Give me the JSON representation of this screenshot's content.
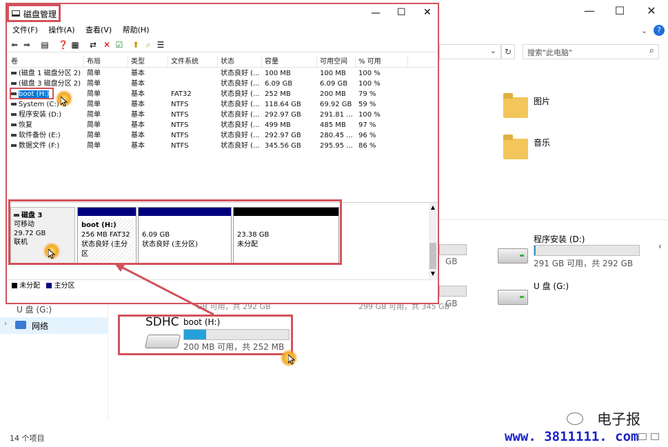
{
  "explorer": {
    "search_placeholder": "搜索\"此电脑\"",
    "nav_network": "网络",
    "nav_partial": "U 盘 (G:)",
    "status_items": "14 个项目",
    "folders": [
      {
        "label": "图片",
        "icon": "pictures-folder-icon"
      },
      {
        "label": "音乐",
        "icon": "music-folder-icon"
      }
    ],
    "drives": [
      {
        "name": "程序安装 (D:)",
        "free_text": "291 GB 可用，共 292 GB",
        "fill": 0.01
      },
      {
        "name": "U 盘 (G:)",
        "free_text": ""
      }
    ],
    "partial_drive_texts": [
      "GB",
      "GB",
      "GB 可用，共 292 GB",
      "299 GB 可用，共 345 GB"
    ],
    "sd_drive": {
      "badge": "SDHC",
      "name": "boot (H:)",
      "free_text": "200 MB 可用，共 252 MB",
      "fill": 0.21
    },
    "watermark_brand": "电子报",
    "watermark_url": "www. 3811111. com"
  },
  "disk_mgmt": {
    "title": "磁盘管理",
    "menu": [
      "文件(F)",
      "操作(A)",
      "查看(V)",
      "帮助(H)"
    ],
    "columns": [
      "卷",
      "布局",
      "类型",
      "文件系统",
      "状态",
      "容量",
      "可用空间",
      "% 可用"
    ],
    "volumes": [
      [
        "(磁盘 1 磁盘分区 2)",
        "简单",
        "基本",
        "",
        "状态良好 (...",
        "100 MB",
        "100 MB",
        "100 %"
      ],
      [
        "(磁盘 3 磁盘分区 2)",
        "简单",
        "基本",
        "",
        "状态良好 (...",
        "6.09 GB",
        "6.09 GB",
        "100 %"
      ],
      [
        "boot (H:)",
        "简单",
        "基本",
        "FAT32",
        "状态良好 (...",
        "252 MB",
        "200 MB",
        "79 %"
      ],
      [
        "System (C:)",
        "简单",
        "基本",
        "NTFS",
        "状态良好 (...",
        "118.64 GB",
        "69.92 GB",
        "59 %"
      ],
      [
        "程序安装 (D:)",
        "简单",
        "基本",
        "NTFS",
        "状态良好 (...",
        "292.97 GB",
        "291.81 ...",
        "100 %"
      ],
      [
        "恢复",
        "简单",
        "基本",
        "NTFS",
        "状态良好 (...",
        "499 MB",
        "485 MB",
        "97 %"
      ],
      [
        "软件备份 (E:)",
        "简单",
        "基本",
        "NTFS",
        "状态良好 (...",
        "292.97 GB",
        "280.45 ...",
        "96 %"
      ],
      [
        "数据文件 (F:)",
        "简单",
        "基本",
        "NTFS",
        "状态良好 (...",
        "345.56 GB",
        "295.95 ...",
        "86 %"
      ]
    ],
    "disk": {
      "name": "磁盘 3",
      "kind": "可移动",
      "size": "29.72 GB",
      "state": "联机",
      "partitions": [
        {
          "title": "boot  (H:)",
          "line1": "256 MB FAT32",
          "line2": "状态良好 (主分区",
          "band": "#00007f"
        },
        {
          "title": "",
          "line1": "6.09 GB",
          "line2": "状态良好 (主分区)",
          "band": "#00007f"
        },
        {
          "title": "",
          "line1": "23.38 GB",
          "line2": "未分配",
          "band": "#000000"
        }
      ]
    },
    "legend": {
      "unallocated": "未分配",
      "primary": "主分区"
    }
  }
}
